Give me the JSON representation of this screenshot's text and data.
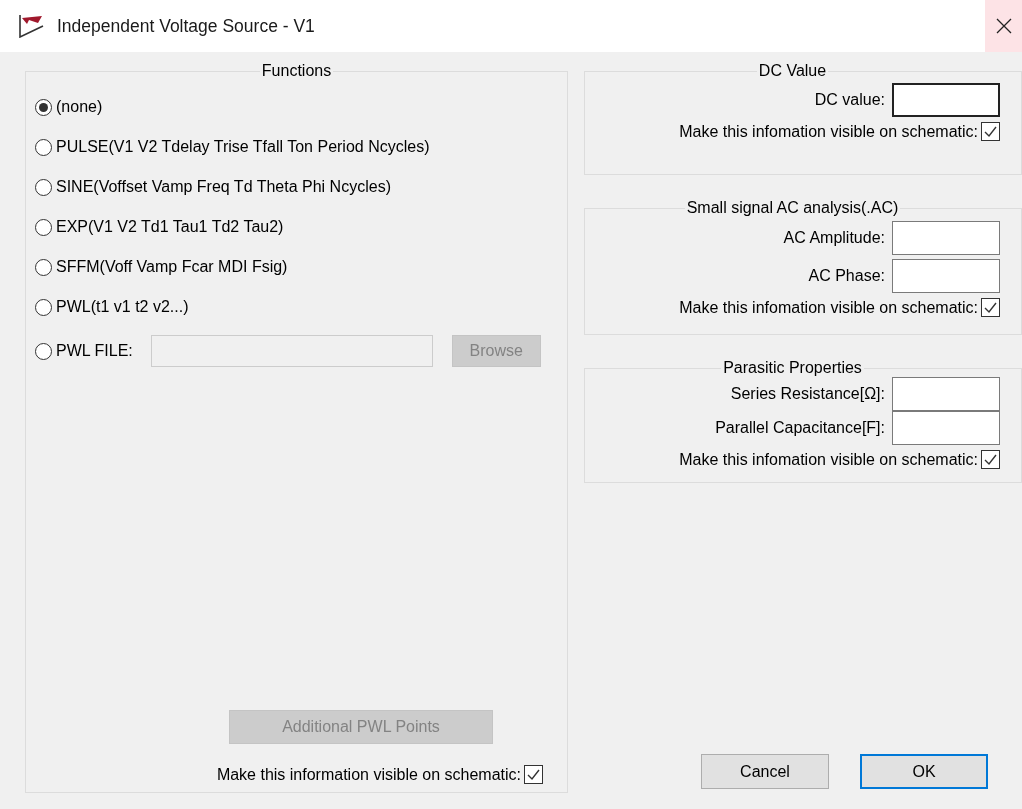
{
  "window": {
    "title": "Independent Voltage Source - V1"
  },
  "functions": {
    "title": "Functions",
    "options": [
      {
        "label": "(none)",
        "selected": true,
        "kind": "plain"
      },
      {
        "label": "PULSE(V1 V2 Tdelay Trise Tfall Ton Period Ncycles)",
        "selected": false,
        "kind": "plain"
      },
      {
        "label": "SINE(Voffset Vamp Freq Td Theta Phi Ncycles)",
        "selected": false,
        "kind": "plain"
      },
      {
        "label": "EXP(V1 V2 Td1 Tau1 Td2 Tau2)",
        "selected": false,
        "kind": "plain"
      },
      {
        "label": "SFFM(Voff Vamp Fcar MDI Fsig)",
        "selected": false,
        "kind": "plain"
      },
      {
        "label": "PWL(t1 v1 t2 v2...)",
        "selected": false,
        "kind": "plain"
      },
      {
        "label": "PWL FILE:",
        "selected": false,
        "kind": "file",
        "browse": {
          "label": "Browse",
          "disabled": true
        }
      }
    ],
    "extra_button": {
      "label": "Additional PWL Points",
      "disabled": true
    },
    "visible": {
      "label": "Make this information visible on schematic:",
      "checked": true
    }
  },
  "groups": [
    {
      "title": "DC Value",
      "fields": [
        {
          "label": "DC value:",
          "focused": true
        }
      ],
      "visible": {
        "label": "Make this infomation visible on schematic:",
        "checked": true
      }
    },
    {
      "title": "Small signal AC analysis(.AC)",
      "fields": [
        {
          "label": "AC Amplitude:",
          "focused": false
        },
        {
          "label": "AC Phase:",
          "focused": false
        }
      ],
      "visible": {
        "label": "Make this infomation visible on schematic:",
        "checked": true
      }
    },
    {
      "title": "Parasitic Properties",
      "fields": [
        {
          "label": "Series Resistance[Ω]:",
          "focused": false
        },
        {
          "label": "Parallel Capacitance[F]:",
          "focused": false
        }
      ],
      "visible": {
        "label": "Make this infomation visible on schematic:",
        "checked": true
      }
    }
  ],
  "buttons": [
    {
      "label": "Cancel",
      "default": false
    },
    {
      "label": "OK",
      "default": true
    }
  ]
}
